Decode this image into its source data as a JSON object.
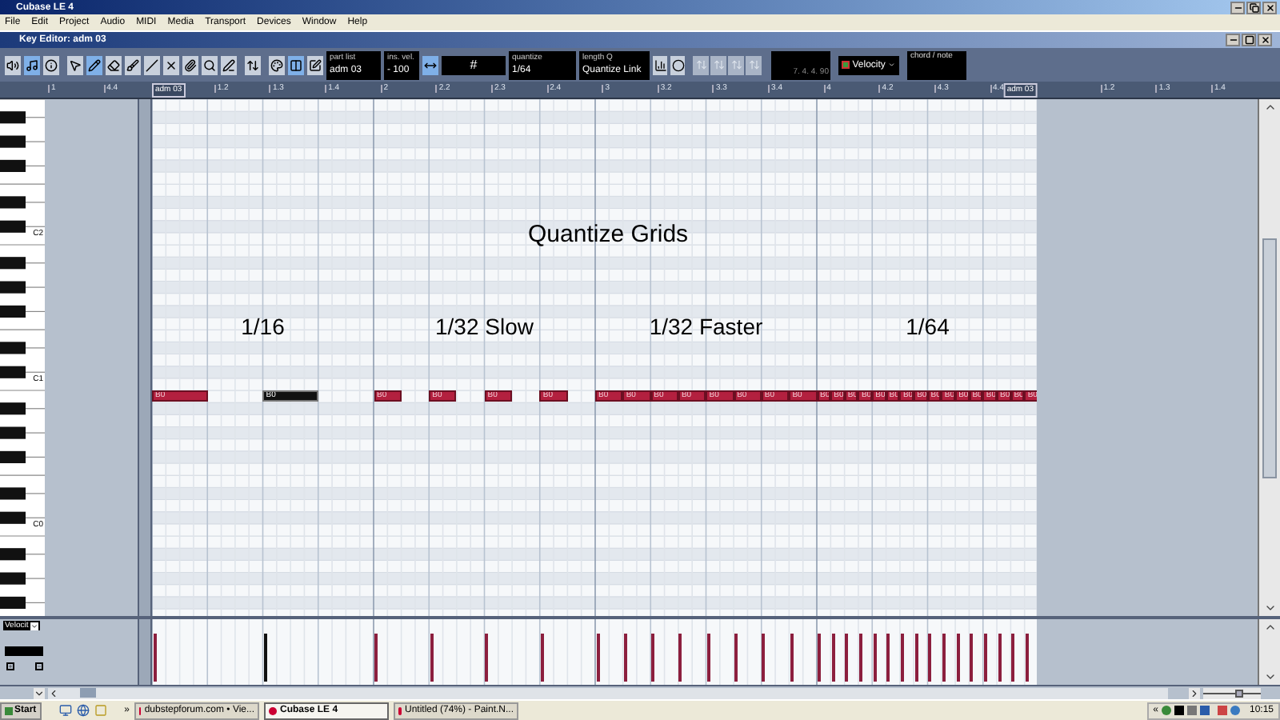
{
  "app_window": {
    "title": "Cubase LE 4"
  },
  "menu": [
    "File",
    "Edit",
    "Project",
    "Audio",
    "MIDI",
    "Media",
    "Transport",
    "Devices",
    "Window",
    "Help"
  ],
  "editor": {
    "title": "Key Editor: adm 03"
  },
  "toolbar": {
    "tools": [
      {
        "kind": "speaker",
        "selected": false
      },
      {
        "kind": "solo",
        "selected": true
      },
      {
        "kind": "info",
        "selected": false
      },
      {
        "kind": "arrow",
        "selected": false
      },
      {
        "kind": "pencil",
        "selected": true
      },
      {
        "kind": "eraser",
        "selected": false
      },
      {
        "kind": "brush",
        "selected": false
      },
      {
        "kind": "line",
        "selected": false
      },
      {
        "kind": "mute",
        "selected": false
      },
      {
        "kind": "glue",
        "selected": false
      },
      {
        "kind": "zoom",
        "selected": false
      },
      {
        "kind": "draw",
        "selected": false
      },
      {
        "kind": "transpose",
        "selected": false
      },
      {
        "kind": "colors",
        "selected": false
      },
      {
        "kind": "parts",
        "selected": true
      },
      {
        "kind": "edit",
        "selected": false
      }
    ],
    "part_list": {
      "label": "part list",
      "value": "adm 03"
    },
    "insert_velocity": {
      "label": "ins. vel.",
      "value": "- 100"
    },
    "grid": {
      "value": "#"
    },
    "quantize": {
      "label": "quantize",
      "value": "1/64"
    },
    "length_q": {
      "label": "length Q",
      "value": "Quantize Link"
    },
    "nudge_buttons": [
      {
        "disabled": true
      },
      {
        "disabled": true
      },
      {
        "disabled": true
      },
      {
        "disabled": true
      }
    ],
    "position": "7. 4. 4. 90",
    "controller": "Velocity",
    "chord": {
      "label": "chord / note"
    }
  },
  "ruler": [
    {
      "kind": "tick",
      "label": "1"
    },
    {
      "kind": "tick",
      "label": "4.4"
    },
    {
      "kind": "part",
      "label": "adm 03"
    },
    {
      "kind": "tick",
      "label": "1.2"
    },
    {
      "kind": "tick",
      "label": "1.3"
    },
    {
      "kind": "tick",
      "label": "1.4"
    },
    {
      "kind": "tick",
      "label": "2"
    },
    {
      "kind": "tick",
      "label": "2.2"
    },
    {
      "kind": "tick",
      "label": "2.3"
    },
    {
      "kind": "tick",
      "label": "2.4"
    },
    {
      "kind": "tick",
      "label": "3"
    },
    {
      "kind": "tick",
      "label": "3.2"
    },
    {
      "kind": "tick",
      "label": "3.3"
    },
    {
      "kind": "tick",
      "label": "3.4"
    },
    {
      "kind": "tick",
      "label": "4"
    },
    {
      "kind": "tick",
      "label": "4.2"
    },
    {
      "kind": "tick",
      "label": "4.3"
    },
    {
      "kind": "tick",
      "label": "4.4"
    },
    {
      "kind": "end",
      "label": "adm 03"
    },
    {
      "kind": "tick",
      "label": "1.2"
    },
    {
      "kind": "tick",
      "label": "1.3"
    },
    {
      "kind": "tick",
      "label": "1.4"
    }
  ],
  "keyboard": {
    "octave_labels": [
      "C2",
      "C1",
      "C0"
    ]
  },
  "heading": "Quantize Grids",
  "phrases": [
    {
      "label": "1/16",
      "kind": "gapped",
      "notes": [
        {
          "label": "B0",
          "selected": false
        },
        {
          "label": "B0",
          "selected": true
        }
      ]
    },
    {
      "label": "1/32 Slow",
      "kind": "gapped",
      "notes": [
        {
          "label": "B0",
          "selected": false
        },
        {
          "label": "B0",
          "selected": false
        },
        {
          "label": "B0",
          "selected": false
        },
        {
          "label": "B0",
          "selected": false
        }
      ]
    },
    {
      "label": "1/32 Faster",
      "kind": "legato",
      "notes": [
        {
          "label": "B0",
          "selected": false
        },
        {
          "label": "B0",
          "selected": false
        },
        {
          "label": "B0",
          "selected": false
        },
        {
          "label": "B0",
          "selected": false
        },
        {
          "label": "B0",
          "selected": false
        },
        {
          "label": "B0",
          "selected": false
        },
        {
          "label": "B0",
          "selected": false
        },
        {
          "label": "B0",
          "selected": false
        }
      ]
    },
    {
      "label": "1/64",
      "kind": "legato",
      "notes": [
        {
          "label": "B0",
          "selected": false
        },
        {
          "label": "B0",
          "selected": false
        },
        {
          "label": "B0",
          "selected": false
        },
        {
          "label": "B0",
          "selected": false
        },
        {
          "label": "B0",
          "selected": false
        },
        {
          "label": "B0",
          "selected": false
        },
        {
          "label": "B0",
          "selected": false
        },
        {
          "label": "B0",
          "selected": false
        },
        {
          "label": "B0",
          "selected": false
        },
        {
          "label": "B0",
          "selected": false
        },
        {
          "label": "B0",
          "selected": false
        },
        {
          "label": "B0",
          "selected": false
        },
        {
          "label": "B0",
          "selected": false
        },
        {
          "label": "B0",
          "selected": false
        },
        {
          "label": "B0",
          "selected": false
        },
        {
          "label": "B0",
          "selected": false
        }
      ]
    }
  ],
  "lane": {
    "controller": "Velocit"
  },
  "taskbar": {
    "start": "Start",
    "more": "»",
    "tasks": [
      {
        "label": "dubstepforum.com • Vie...",
        "selected": false
      },
      {
        "label": "Cubase LE 4",
        "selected": true
      },
      {
        "label": "Untitled (74%) - Paint.N...",
        "selected": false
      }
    ],
    "tray_more": "«",
    "clock": "10:15"
  },
  "zoom_slider": {
    "level": 0.65
  }
}
